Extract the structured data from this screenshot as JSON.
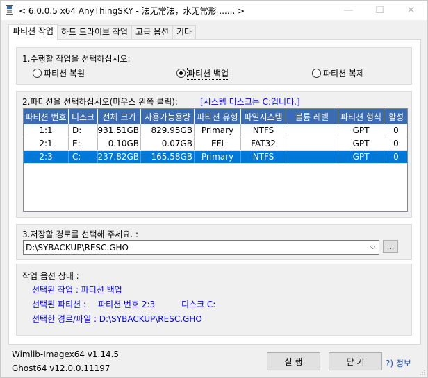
{
  "window": {
    "title": "< 6.0.0.5 x64 AnyThingSKY - 法无常法，水无常形 ...... >",
    "minimize": "—",
    "maximize": "☐",
    "close": "✕"
  },
  "tabs": [
    "파티션 작업",
    "하드 드라이브 작업",
    "고급 옵션",
    "기타"
  ],
  "section1": {
    "label": "1.수행할 작업을 선택하십시오:",
    "options": [
      "파티션 복원",
      "파티션 백업",
      "파티션 복제"
    ],
    "selected": "파티션 백업"
  },
  "section2": {
    "label": "2.파티션을 선택하십시오(마우스 왼쪽 클릭):",
    "system_note": "[시스템 디스크는 C:입니다.]",
    "columns": [
      "파티션 번호",
      "디스크",
      "전체 크기",
      "사용가능용량",
      "파티션 유형",
      "파일시스템",
      "볼륨 레벨",
      "파티션 형식",
      "활성"
    ],
    "rows": [
      {
        "num": "1:1",
        "disk": "D:",
        "size": "931.51GB",
        "free": "829.95GB",
        "type": "Primary",
        "fs": "NTFS",
        "volume": "",
        "format": "GPT",
        "active": "0"
      },
      {
        "num": "2:1",
        "disk": "E:",
        "size": "0.10GB",
        "free": "0.07GB",
        "type": "EFI",
        "fs": "FAT32",
        "volume": "",
        "format": "GPT",
        "active": "0"
      },
      {
        "num": "2:3",
        "disk": "C:",
        "size": "237.82GB",
        "free": "165.58GB",
        "type": "Primary",
        "fs": "NTFS",
        "volume": "",
        "format": "GPT",
        "active": "0"
      }
    ],
    "selected_row": 2
  },
  "section3": {
    "label": "3.저장할 경로를 선택해 주세요. :",
    "path": "D:\\SYBACKUP\\RESC.GHO",
    "browse": "..."
  },
  "status": {
    "title": "작업 옵션 상태 :",
    "task": "선택된 작업 : 파티션 백업",
    "partition_label": "선택된 파티션 :",
    "partition_num": "파티션 번호 2:3",
    "partition_disk": "디스크 C:",
    "path": "선택한 경로/파일 : D:\\SYBACKUP\\RESC.GHO"
  },
  "footer": {
    "wimlib": "Wimlib-Imagex64 v1.14.5",
    "ghost": "Ghost64 v12.0.0.11197",
    "run_label": "실 행",
    "close_label": "닫 기",
    "info_label": "?) 정보"
  },
  "colors": {
    "header_bg": "#3b6cb2",
    "selection": "#0078d7",
    "accent_text": "#0000ff"
  }
}
